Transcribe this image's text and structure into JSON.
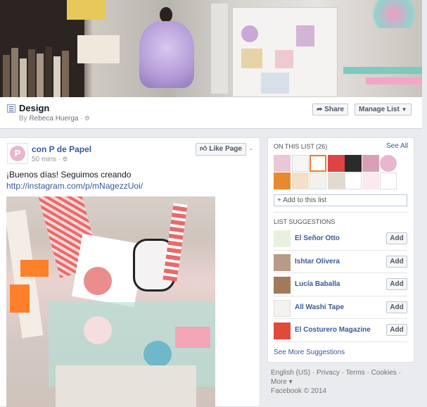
{
  "header": {
    "list_title": "Design",
    "author_prefix": "By",
    "author": "Rebeca Huerga",
    "share_label": "Share",
    "manage_label": "Manage List"
  },
  "post": {
    "page_name": "con P de Papel",
    "time": "50 mins",
    "like_label": "Like Page",
    "text": "¡Buenos días! Seguimos creando",
    "link": "http://instagram.com/p/mNagezzUoi/"
  },
  "sidebar": {
    "on_list_heading": "ON THIS LIST (26)",
    "see_all": "See All",
    "add_placeholder": "+ Add to this list",
    "suggestions_heading": "LIST SUGGESTIONS",
    "suggestions": [
      {
        "name": "El Señor Otto",
        "add": "Add"
      },
      {
        "name": "Ishtar Olivera",
        "add": "Add"
      },
      {
        "name": "Lucía Baballa",
        "add": "Add"
      },
      {
        "name": "All Washi Tape",
        "add": "Add"
      },
      {
        "name": "El Costurero Magazine",
        "add": "Add"
      }
    ],
    "see_more": "See More Suggestions"
  },
  "footer": {
    "links": [
      "English (US)",
      "Privacy",
      "Terms",
      "Cookies",
      "More"
    ],
    "copyright": "Facebook © 2014"
  },
  "colors": {
    "link": "#3b5998",
    "background": "#e9ebee"
  }
}
